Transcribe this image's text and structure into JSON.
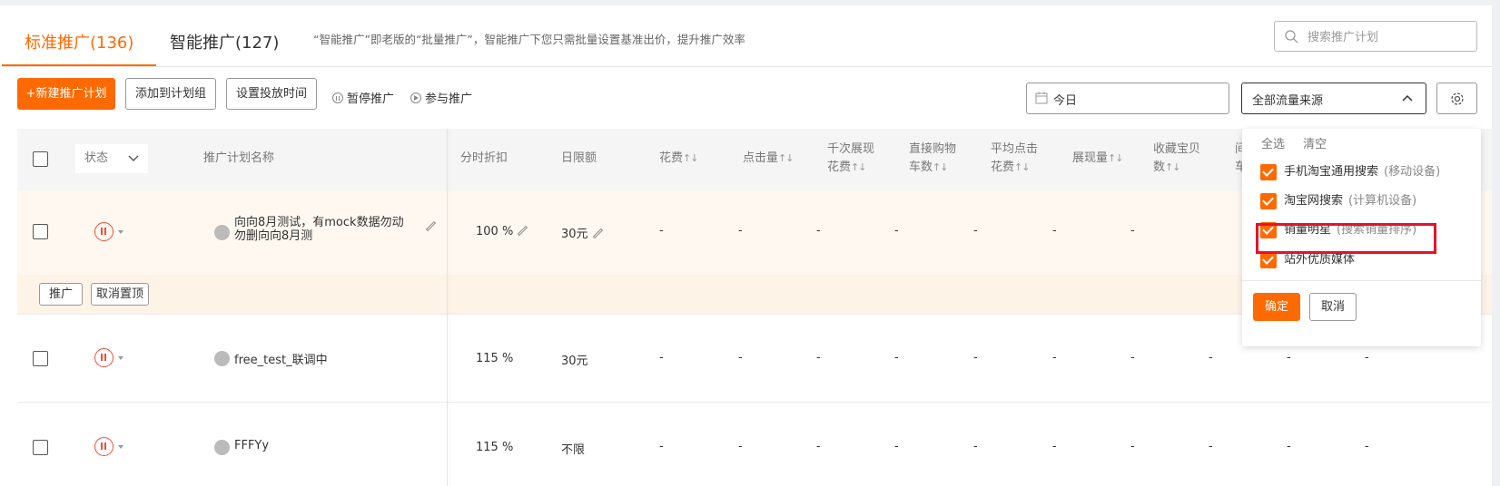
{
  "tabs": [
    {
      "label": "标准推广(136)",
      "active": true
    },
    {
      "label": "智能推广(127)",
      "active": false
    }
  ],
  "hint": "“智能推广”即老版的“批量推广”，智能推广下您只需批量设置基准出价，提升推广效率",
  "search": {
    "placeholder": "搜索推广计划"
  },
  "toolbar": {
    "new_plan": "+新建推广计划",
    "add_group": "添加到计划组",
    "set_time": "设置投放时间",
    "pause": "暂停推广",
    "join": "参与推广"
  },
  "date_filter": {
    "value": "今日"
  },
  "traffic_select": {
    "value": "全部流量来源"
  },
  "table": {
    "headers": {
      "status": "状态",
      "name": "推广计划名称",
      "discount": "分时折扣",
      "daily_limit": "日限额",
      "cost": "花费",
      "clicks": "点击量",
      "cpm_line1": "千次展现",
      "cpm_line2": "花费",
      "cart_line1": "直接购物",
      "cart_line2": "车数",
      "cpc_line1": "平均点击",
      "cpc_line2": "花费",
      "impressions": "展现量",
      "fav_line1": "收藏宝贝",
      "fav_line2": "数",
      "cut1": "间",
      "cut2": "车"
    },
    "sort_glyph": "↑↓",
    "rows": [
      {
        "name": "向向8月测试，有mock数据勿动勿删向向8月测",
        "discount": "100 %",
        "limit": "30元",
        "dash": "-"
      },
      {
        "name": "free_test_联调中",
        "discount": "115 %",
        "limit": "30元",
        "dash": "-"
      },
      {
        "name": "FFFYy",
        "discount": "115 %",
        "limit": "不限",
        "dash": "-"
      }
    ],
    "pinned_actions": {
      "promote": "推广",
      "unpin": "取消置顶"
    }
  },
  "dropdown": {
    "select_all": "全选",
    "clear": "清空",
    "options": [
      {
        "label": "手机淘宝通用搜索",
        "sub": "(移动设备)",
        "checked": true
      },
      {
        "label": "淘宝网搜索",
        "sub": "(计算机设备)",
        "checked": true
      },
      {
        "label": "销量明星",
        "sub": "(搜索销量排序)",
        "checked": true
      },
      {
        "label": "站外优质媒体",
        "sub": "",
        "checked": true
      }
    ],
    "confirm": "确定",
    "cancel": "取消"
  },
  "colors": {
    "accent": "#ff6a00",
    "highlight": "#e8102b",
    "paused": "#e8503a"
  }
}
